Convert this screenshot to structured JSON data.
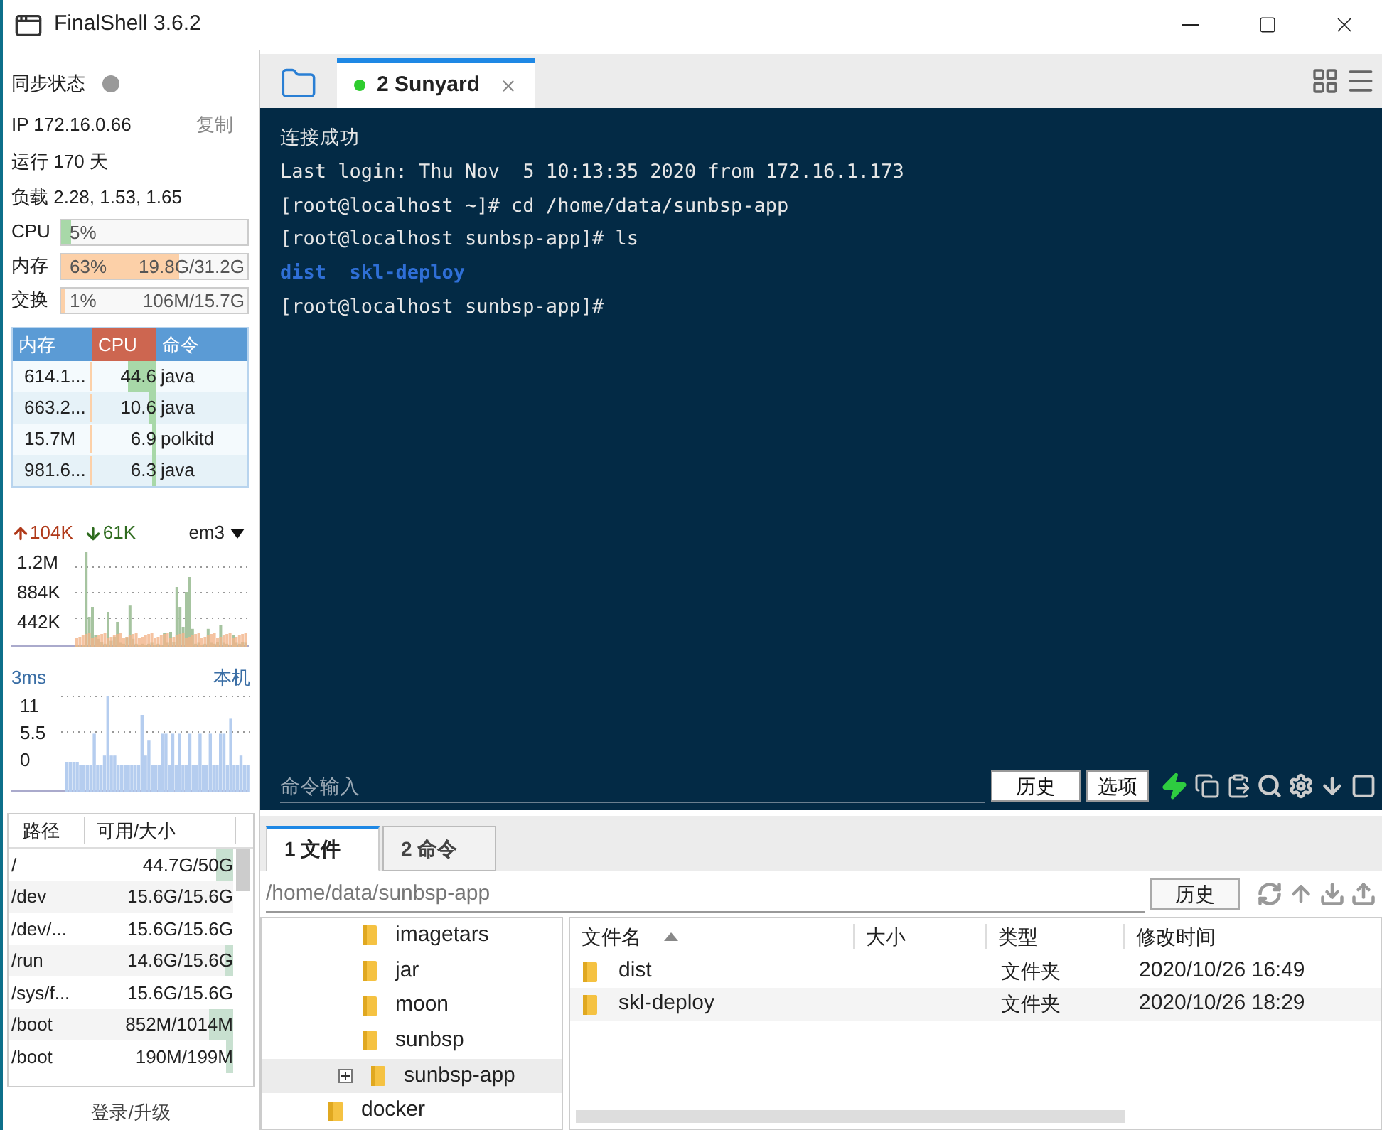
{
  "window": {
    "title": "FinalShell 3.6.2"
  },
  "sidebar": {
    "sync_label": "同步状态",
    "ip": "IP 172.16.0.66",
    "copy": "复制",
    "uptime": "运行 170 天",
    "load": "负载 2.28, 1.53, 1.65",
    "meters": [
      {
        "label": "CPU",
        "level": 0.05,
        "percent": "5%",
        "kind": "cpu"
      },
      {
        "label": "内存",
        "level": 0.63,
        "percent": "63%",
        "detail": "19.8G/31.2G",
        "kind": "mem"
      },
      {
        "label": "交换",
        "level": 0.01,
        "percent": "1%",
        "detail": "106M/15.7G",
        "kind": "mem"
      }
    ],
    "process_columns": [
      "内存",
      "CPU",
      "命令"
    ],
    "processes": [
      {
        "mem": "614.1...",
        "cpu": "44.6",
        "cmd": "java"
      },
      {
        "mem": "663.2...",
        "cpu": "10.6",
        "cmd": "java"
      },
      {
        "mem": "15.7M",
        "cpu": "6.9",
        "cmd": "polkitd"
      },
      {
        "mem": "981.6...",
        "cpu": "6.3",
        "cmd": "java"
      }
    ],
    "network": {
      "up": "104K",
      "down": "61K",
      "interface": "em3",
      "ticks": [
        "1.2M",
        "884K",
        "442K"
      ]
    },
    "latency": {
      "value": "3ms",
      "host": "本机",
      "ticks": [
        "11",
        "5.5",
        "0"
      ]
    },
    "disk_columns": [
      "路径",
      "可用/大小"
    ],
    "disks": [
      {
        "path": "/",
        "size": "44.7G/50G",
        "level": 0.11
      },
      {
        "path": "/dev",
        "size": "15.6G/15.6G"
      },
      {
        "path": "/dev/...",
        "size": "15.6G/15.6G"
      },
      {
        "path": "/run",
        "size": "14.6G/15.6G",
        "level": 0.06
      },
      {
        "path": "/sys/f...",
        "size": "15.6G/15.6G"
      },
      {
        "path": "/boot",
        "size": "852M/1014M",
        "level": 0.16
      },
      {
        "path": "/boot",
        "size": "190M/199M",
        "level": 0.05
      }
    ],
    "login": "登录/升级"
  },
  "tabs": [
    {
      "label": "2 Sunyard",
      "selected": true,
      "connected": true
    }
  ],
  "terminal": {
    "lines": [
      {
        "kind": "plain",
        "text": "连接成功"
      },
      {
        "kind": "plain",
        "text": "Last login: Thu Nov  5 10:13:35 2020 from 172.16.1.173"
      },
      {
        "kind": "plain",
        "text": "[root@localhost ~]# cd /home/data/sunbsp-app"
      },
      {
        "kind": "plain",
        "text": "[root@localhost sunbsp-app]# ls"
      },
      {
        "kind": "dir",
        "text": "dist  skl-deploy"
      },
      {
        "kind": "plain",
        "text": "[root@localhost sunbsp-app]#"
      }
    ],
    "command_placeholder": "命令输入",
    "buttons": [
      "历史",
      "选项"
    ]
  },
  "bottom_tabs": [
    {
      "label": "1 文件",
      "selected": true
    },
    {
      "label": "2 命令",
      "selected": false
    }
  ],
  "path": {
    "value": "/home/data/sunbsp-app",
    "history": "历史"
  },
  "tree": [
    {
      "children": [
        {
          "label": "imagetars",
          "selected": false
        },
        {
          "label": "jar",
          "selected": false
        },
        {
          "label": "moon",
          "selected": false
        },
        {
          "label": "sunbsp",
          "selected": false
        },
        {
          "label": "sunbsp-app",
          "selected": true,
          "expandable": true
        }
      ]
    },
    {
      "label": "docker",
      "selected": false
    }
  ],
  "files": {
    "columns": [
      {
        "label": "文件名",
        "sorted": true
      },
      {
        "label": "大小",
        "sorted": false
      },
      {
        "label": "类型",
        "sorted": false
      },
      {
        "label": "修改时间",
        "sorted": false
      }
    ],
    "rows": [
      {
        "name": "dist",
        "size": "",
        "type": "文件夹",
        "modified": "2020/10/26 16:49"
      },
      {
        "name": "skl-deploy",
        "size": "",
        "type": "文件夹",
        "modified": "2020/10/26 18:29"
      }
    ]
  }
}
